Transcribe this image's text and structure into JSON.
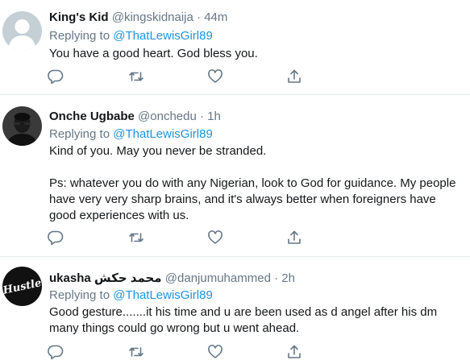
{
  "tweets": [
    {
      "name": "King's Kid",
      "handle": "@kingskidnaija",
      "separator": "·",
      "time": "44m",
      "replying_prefix": "Replying to",
      "replying_to": "@ThatLewisGirl89",
      "text": [
        "You have a good heart. God bless you."
      ],
      "avatar": "default-avatar"
    },
    {
      "name": "Onche Ugbabe",
      "handle": "@onchedu",
      "separator": "·",
      "time": "1h",
      "replying_prefix": "Replying to",
      "replying_to": "@ThatLewisGirl89",
      "text": [
        "Kind of you. May you never be stranded.",
        "Ps: whatever you do with any Nigerian, look to God for guidance. My people have very very sharp brains, and it's always better when foreigners have good experiences with us."
      ],
      "avatar": "photo-avatar"
    },
    {
      "name": "ukasha محمد حكش",
      "handle": "@danjumuhammed",
      "separator": "·",
      "time": "2h",
      "replying_prefix": "Replying to",
      "replying_to": "@ThatLewisGirl89",
      "text": [
        "Good gesture.......it his time and u are been used as d angel after his dm many things could go wrong but u went ahead."
      ],
      "avatar": "hustle-logo-avatar",
      "avatar_logo_text": "Hustle"
    }
  ],
  "icons": {
    "reply": "reply-icon",
    "retweet": "retweet-icon",
    "like": "heart-icon",
    "share": "share-icon"
  },
  "colors": {
    "primary_text": "#14171a",
    "secondary_text": "#657786",
    "link": "#1b95e0",
    "divider": "#e6ecf0"
  }
}
